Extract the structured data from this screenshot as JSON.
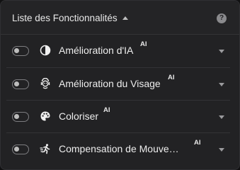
{
  "header": {
    "title": "Liste des Fonctionnalités",
    "caret_icon": "caret-up-icon",
    "help_icon": "help-circle-icon",
    "help_glyph": "?"
  },
  "features": [
    {
      "label": "Amélioration d'IA",
      "badge": "AI",
      "icon": "contrast-half-circle-icon",
      "enabled": false
    },
    {
      "label": "Amélioration du Visage",
      "badge": "AI",
      "icon": "face-enhance-icon",
      "enabled": false
    },
    {
      "label": "Coloriser",
      "badge": "AI",
      "icon": "palette-icon",
      "enabled": false
    },
    {
      "label": "Compensation de Mouve…",
      "badge": "AI",
      "icon": "running-person-icon",
      "enabled": false
    }
  ],
  "colors": {
    "panel_bg": "#222224",
    "text": "#ededed",
    "toggle_off": "#7d7d80"
  }
}
